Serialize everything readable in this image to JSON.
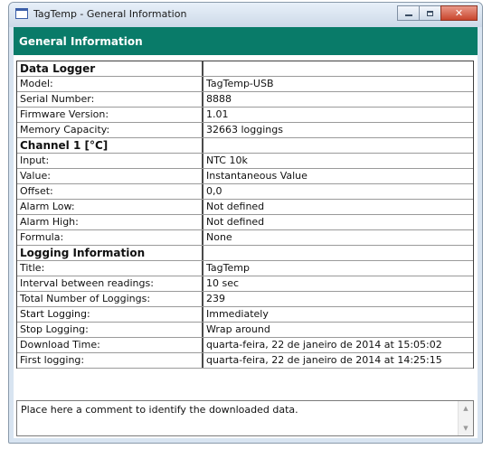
{
  "window": {
    "title": "TagTemp - General Information",
    "icon": "tagtemp-app-icon",
    "controls": {
      "minimize": "minimize-icon",
      "maximize": "maximize-icon",
      "close": "close-icon"
    }
  },
  "header": {
    "title": "General Information"
  },
  "sections": [
    {
      "title": "Data Logger",
      "rows": [
        {
          "label": "Model:",
          "value": "TagTemp-USB"
        },
        {
          "label": "Serial Number:",
          "value": "8888"
        },
        {
          "label": "Firmware Version:",
          "value": "1.01"
        },
        {
          "label": "Memory Capacity:",
          "value": "32663 loggings"
        }
      ]
    },
    {
      "title": "Channel 1 [°C]",
      "rows": [
        {
          "label": "Input:",
          "value": "NTC 10k"
        },
        {
          "label": "Value:",
          "value": "Instantaneous Value"
        },
        {
          "label": "Offset:",
          "value": "0,0"
        },
        {
          "label": "Alarm Low:",
          "value": "Not defined"
        },
        {
          "label": "Alarm High:",
          "value": "Not defined"
        },
        {
          "label": "Formula:",
          "value": "None"
        }
      ]
    },
    {
      "title": "Logging Information",
      "rows": [
        {
          "label": "Title:",
          "value": "TagTemp"
        },
        {
          "label": "Interval between readings:",
          "value": "10 sec"
        },
        {
          "label": "Total Number of Loggings:",
          "value": "239"
        },
        {
          "label": "Start Logging:",
          "value": "Immediately"
        },
        {
          "label": "Stop Logging:",
          "value": "Wrap around"
        },
        {
          "label": "Download Time:",
          "value": "quarta-feira, 22 de janeiro de 2014 at 15:05:02"
        },
        {
          "label": "First logging:",
          "value": "quarta-feira, 22 de janeiro de 2014 at 14:25:15"
        }
      ]
    }
  ],
  "comment": {
    "text": "Place here a comment to identify the downloaded data."
  },
  "colors": {
    "header_band": "#097b69",
    "close_button": "#c9452c"
  }
}
